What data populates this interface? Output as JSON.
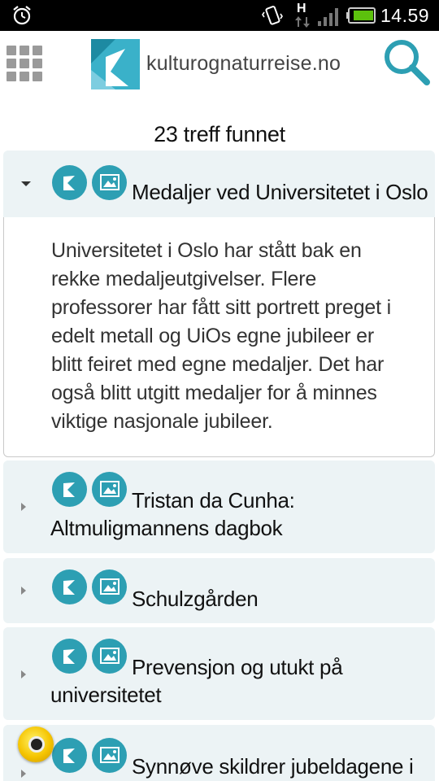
{
  "status_bar": {
    "time": "14.59",
    "network_label": "H",
    "icons": [
      "alarm-icon",
      "vibrate-icon",
      "network-h-icon",
      "signal-icon",
      "battery-icon"
    ]
  },
  "header": {
    "logo_text": "kulturognaturreise.no",
    "menu_icon": "grid-menu-icon",
    "search_icon": "search-icon"
  },
  "results": {
    "count_text": "23 treff funnet",
    "items": [
      {
        "title": "Medaljer ved Universitetet i Oslo",
        "expanded": true,
        "description": "Universitetet i Oslo har stått bak en rekke medaljeutgivelser. Flere professorer har fått sitt portrett preget i edelt metall og UiOs egne jubileer er blitt feiret med egne medaljer. Det har også blitt utgitt medaljer for å minnes viktige nasjonale jubileer."
      },
      {
        "title_line1": "Tristan da Cunha:",
        "title_line2": "Altmuligmannens dagbok",
        "expanded": false
      },
      {
        "title": "Schulzgården",
        "expanded": false
      },
      {
        "title_line1": "Prevensjon og utukt på",
        "title_line2": "universitetet",
        "expanded": false
      },
      {
        "title": "Synnøve skildrer jubeldagene i",
        "expanded": false
      }
    ]
  },
  "colors": {
    "accent": "#2d9fb3",
    "item_background": "#ecf3f5",
    "status_bar": "#000000"
  }
}
